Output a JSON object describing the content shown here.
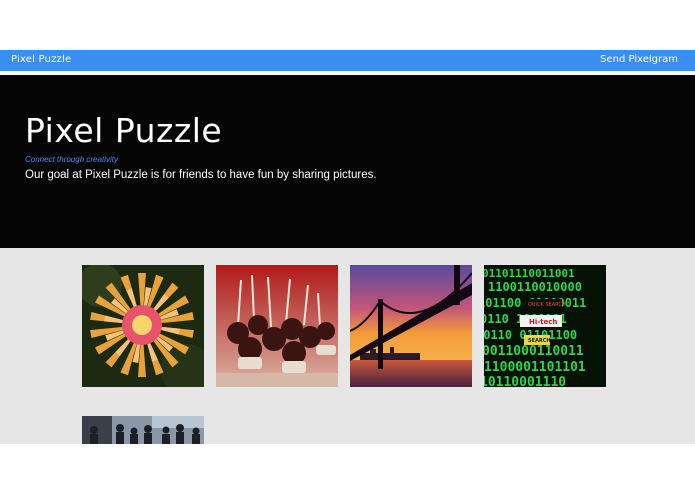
{
  "navbar": {
    "brand": "Pixel Puzzle",
    "send_link": "Send Pixelgram"
  },
  "hero": {
    "title": "Pixel Puzzle",
    "tagline": "Connect through creativity",
    "description": "Our goal at Pixel Puzzle is for friends to have fun by sharing pictures."
  },
  "gallery": {
    "images": [
      {
        "name": "flower-photo"
      },
      {
        "name": "cake-pops-photo"
      },
      {
        "name": "bridge-sunset-photo"
      },
      {
        "name": "binary-code-photo",
        "words": [
          "QUICK SEARCH",
          "Hi-tech",
          "SEARCH"
        ]
      },
      {
        "name": "crowd-event-photo"
      }
    ]
  },
  "colors": {
    "navbar": "#3a8ef0",
    "hero_background": "#050505",
    "gallery_background": "#e6e6e6"
  }
}
